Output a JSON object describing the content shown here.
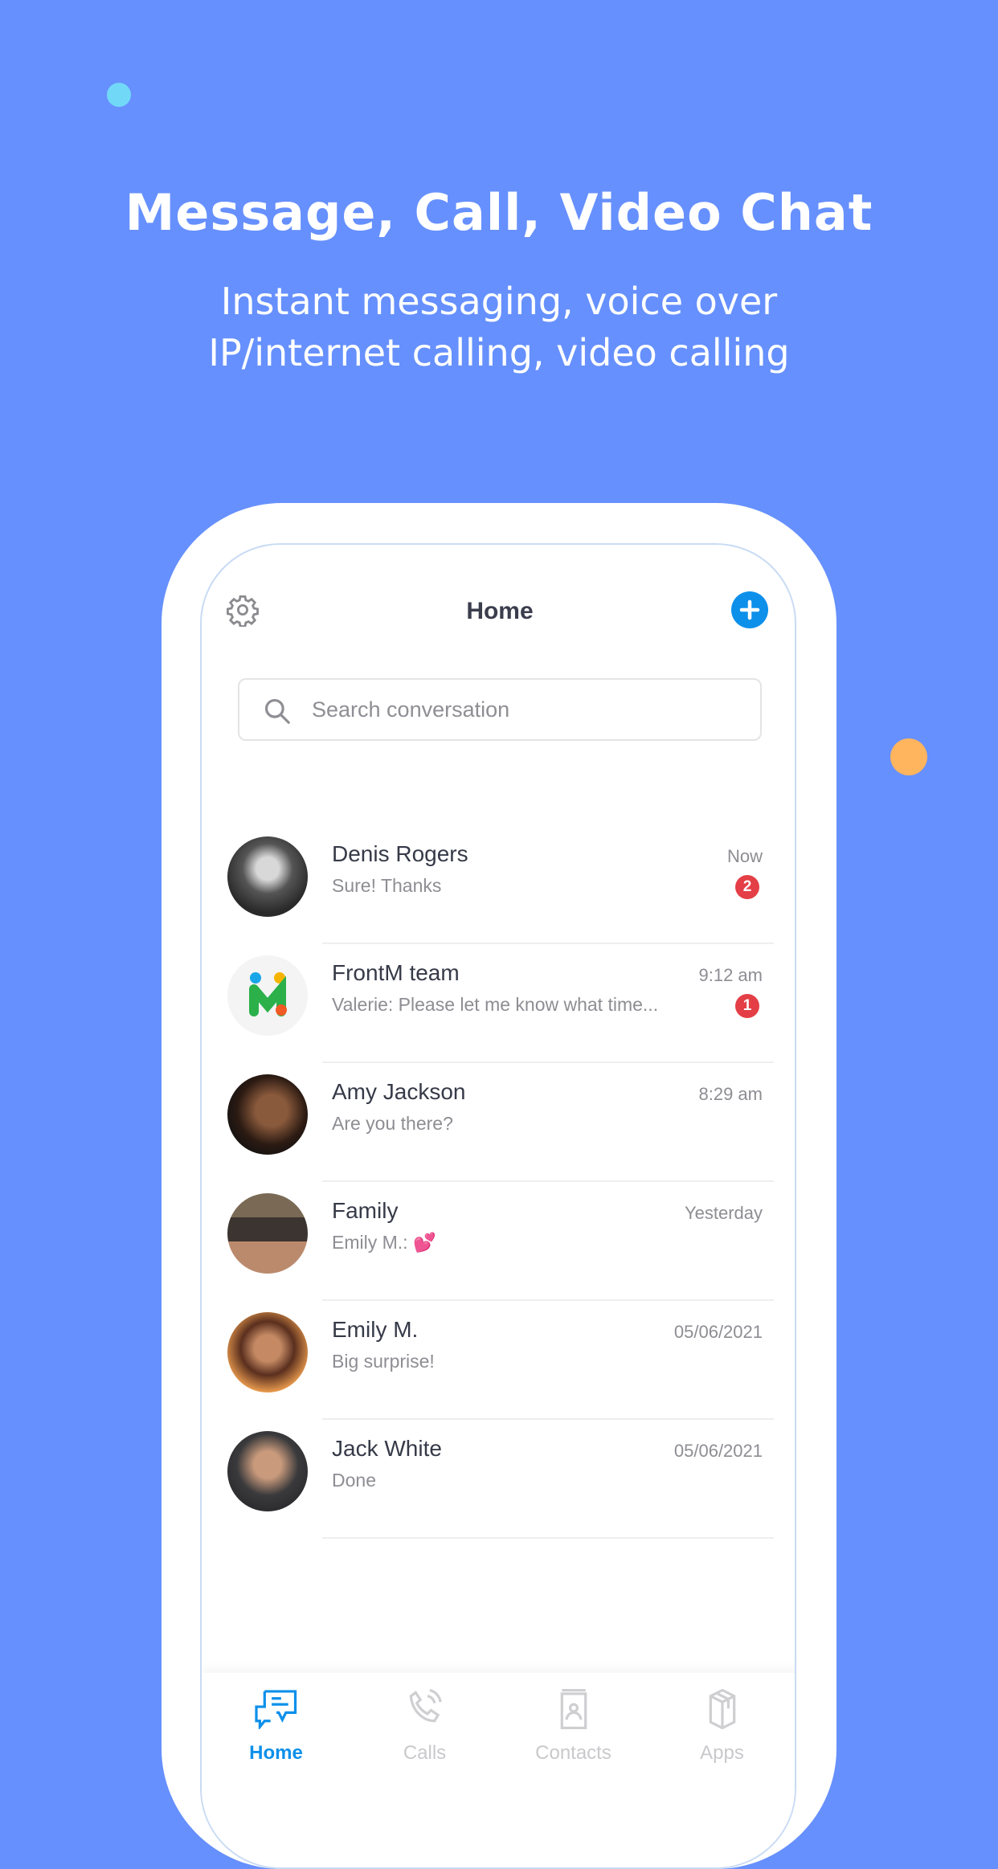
{
  "hero": {
    "title": "Message, Call, Video Chat",
    "subtitle_lines": [
      "Instant messaging, voice over",
      "IP/internet calling, video calling"
    ]
  },
  "colors": {
    "background": "#6690fd",
    "accent": "#0d90ea",
    "badge": "#e43f46",
    "dot_cyan": "#72d8f7",
    "dot_orange": "#ffb45e"
  },
  "header": {
    "title": "Home",
    "settings_icon": "gear-icon",
    "add_icon": "plus-icon"
  },
  "search": {
    "placeholder": "Search conversation",
    "value": ""
  },
  "conversations": [
    {
      "name": "Denis Rogers",
      "message": "Sure! Thanks",
      "time": "Now",
      "unread": "2"
    },
    {
      "name": "FrontM team",
      "message": "Valerie: Please let me know what time...",
      "time": "9:12 am",
      "unread": "1"
    },
    {
      "name": "Amy Jackson",
      "message": "Are you there?",
      "time": "8:29 am"
    },
    {
      "name": "Family",
      "message": "Emily M.: 💕",
      "time": "Yesterday"
    },
    {
      "name": "Emily M.",
      "message": "Big surprise!",
      "time": "05/06/2021"
    },
    {
      "name": "Jack White",
      "message": "Done",
      "time": "05/06/2021"
    }
  ],
  "tabs": [
    {
      "label": "Home",
      "active": true
    },
    {
      "label": "Calls"
    },
    {
      "label": "Contacts"
    },
    {
      "label": "Apps"
    }
  ]
}
